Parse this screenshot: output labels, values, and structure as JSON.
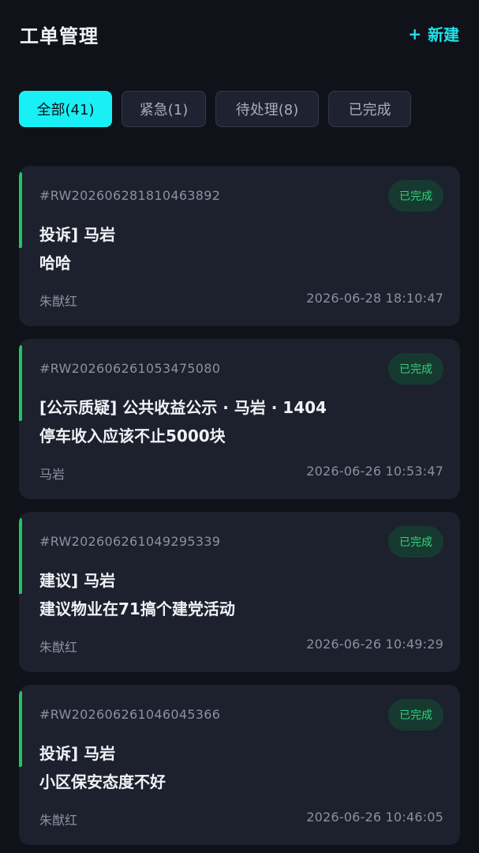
{
  "header": {
    "title": "工单管理",
    "new_icon": "+",
    "new_label": "新建"
  },
  "filters": [
    {
      "label": "全部(41)",
      "active": true
    },
    {
      "label": "紧急(1)",
      "active": false
    },
    {
      "label": "待处理(8)",
      "active": false
    },
    {
      "label": "已完成",
      "active": false
    }
  ],
  "colors": {
    "accent": "#19f0f5",
    "status_done": "#2fd27a",
    "card_bar": "#22c55e",
    "background": "#10121a"
  },
  "tickets": [
    {
      "id": "#RW202606281810463892",
      "status": "已完成",
      "title": "投诉] 马岩",
      "description": "哈哈",
      "assignee": "朱猷红",
      "time": "2026-06-28 18:10:47"
    },
    {
      "id": "#RW202606261053475080",
      "status": "已完成",
      "title": "[公示质疑] 公共收益公示 · 马岩 · 1404",
      "description": "停车收入应该不止5000块",
      "assignee": "马岩",
      "time": "2026-06-26 10:53:47"
    },
    {
      "id": "#RW202606261049295339",
      "status": "已完成",
      "title": "建议] 马岩",
      "description": "建议物业在71搞个建党活动",
      "assignee": "朱猷红",
      "time": "2026-06-26 10:49:29"
    },
    {
      "id": "#RW202606261046045366",
      "status": "已完成",
      "title": "投诉] 马岩",
      "description": "小区保安态度不好",
      "assignee": "朱猷红",
      "time": "2026-06-26 10:46:05"
    }
  ]
}
